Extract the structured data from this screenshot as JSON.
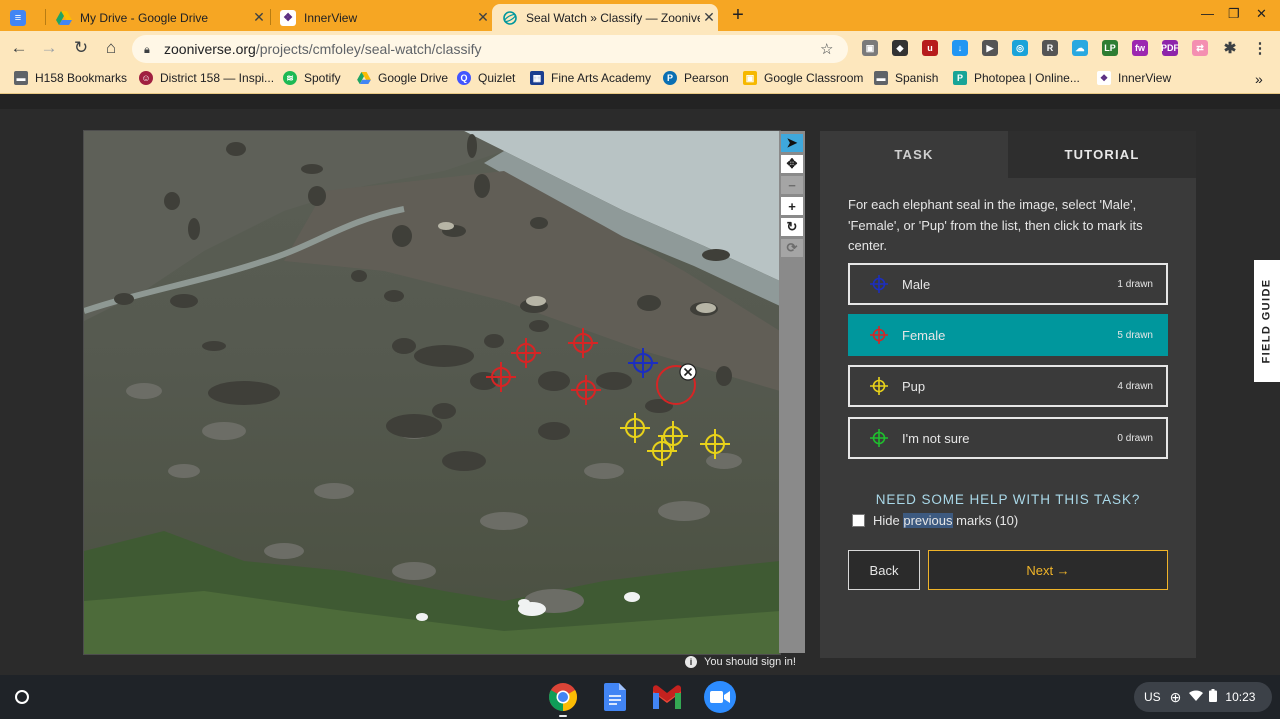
{
  "browser": {
    "tabs": [
      {
        "title": "My Drive - Google Drive",
        "icon": "google-drive-icon"
      },
      {
        "title": "InnerView",
        "icon": "innerview-icon"
      },
      {
        "title": "Seal Watch » Classify — Zooniverse",
        "icon": "zooniverse-icon",
        "active": true
      }
    ],
    "url_domain": "zooniverse.org",
    "url_path": "/projects/cmfoley/seal-watch/classify",
    "bookmarks": [
      {
        "label": "H158 Bookmarks",
        "icon": "folder-icon"
      },
      {
        "label": "District 158 — Inspi...",
        "icon": "district-icon"
      },
      {
        "label": "Spotify",
        "icon": "spotify-icon"
      },
      {
        "label": "Google Drive",
        "icon": "google-drive-icon"
      },
      {
        "label": "Quizlet",
        "icon": "quizlet-icon"
      },
      {
        "label": "Fine Arts Academy",
        "icon": "calendar-icon"
      },
      {
        "label": "Pearson",
        "icon": "pearson-icon"
      },
      {
        "label": "Google Classroom",
        "icon": "classroom-icon"
      },
      {
        "label": "Spanish",
        "icon": "folder-icon"
      },
      {
        "label": "Photopea | Online...",
        "icon": "photopea-icon"
      },
      {
        "label": "InnerView",
        "icon": "innerview-icon"
      }
    ],
    "bookmarks_overflow": "»"
  },
  "task_panel": {
    "tabs": [
      "TASK",
      "TUTORIAL"
    ],
    "instruction": "For each elephant seal in the image, select 'Male', 'Female', or 'Pup' from the list, then click to mark its center.",
    "choices": [
      {
        "label": "Male",
        "count": "1 drawn",
        "color": "#1c2ec0"
      },
      {
        "label": "Female",
        "count": "5 drawn",
        "color": "#d62525",
        "selected": true
      },
      {
        "label": "Pup",
        "count": "4 drawn",
        "color": "#e8d21a"
      },
      {
        "label": "I'm not sure",
        "count": "0 drawn",
        "color": "#1fbf2e"
      }
    ],
    "help": "NEED SOME HELP WITH THIS TASK?",
    "hide_marks": {
      "pre": "Hide ",
      "highlight": "previous",
      "post": " marks (10)",
      "checked": false
    },
    "back": "Back",
    "next": "Next →"
  },
  "signin_notice": "You should sign in!",
  "field_guide": "FIELD GUIDE",
  "image_tools": [
    "pointer-icon",
    "pan-icon",
    "zoom-out-icon",
    "zoom-in-icon",
    "rotate-icon",
    "reset-icon"
  ],
  "shelf": {
    "apps": [
      "chrome-icon",
      "google-docs-icon",
      "gmail-icon",
      "zoom-icon"
    ],
    "locale": "US",
    "time": "10:23"
  },
  "colors": {
    "accent": "#00979d",
    "next": "#f0b429",
    "chrome_tabstrip": "#f6a623"
  }
}
